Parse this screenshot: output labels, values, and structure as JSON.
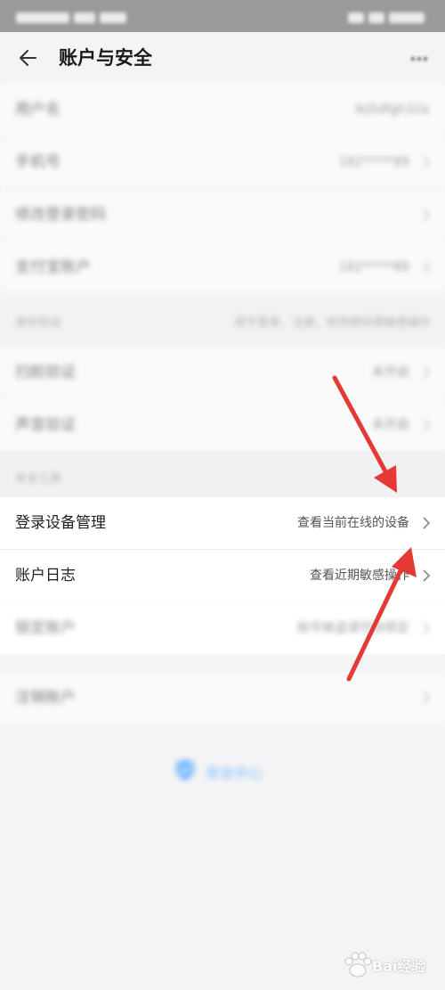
{
  "nav": {
    "title": "账户与安全"
  },
  "rows_top": [
    {
      "label": "用户名",
      "value": "lkj5dfgh32a"
    },
    {
      "label": "手机号",
      "value": "182*****89"
    },
    {
      "label": "修改登录密码",
      "value": ""
    },
    {
      "label": "支付宝账户",
      "value": "182*****89"
    }
  ],
  "section_verify": {
    "label": "身份验证",
    "value": "用于登录、注册、修改密码等敏感操作"
  },
  "rows_verify": [
    {
      "label": "扫脸验证",
      "value": "未开启"
    },
    {
      "label": "声音验证",
      "value": "未开启"
    }
  ],
  "section_tools": {
    "label": "安全工具"
  },
  "rows_tools": [
    {
      "label": "登录设备管理",
      "value": "查看当前在线的设备"
    },
    {
      "label": "账户日志",
      "value": "查看近期敏感操作"
    },
    {
      "label": "锁定账户",
      "value": "账号被盗请尽快锁定"
    }
  ],
  "rows_cancel": [
    {
      "label": "注销账户",
      "value": ""
    }
  ],
  "footer": {
    "brand": "安全中心"
  },
  "watermark": {
    "text": "Bai经验"
  },
  "colors": {
    "accent_arrow": "#e53935",
    "brand_blue": "#3aa0ff"
  }
}
